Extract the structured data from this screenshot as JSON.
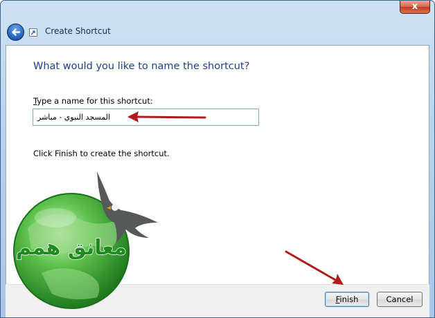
{
  "window": {
    "title": "Create Shortcut",
    "close_glyph": "x",
    "icons": {
      "back": "back-arrow-icon",
      "app": "shortcut-icon",
      "close": "close-icon"
    }
  },
  "wizard": {
    "heading": "What would you like to name the shortcut?",
    "field_label_accesskey": "T",
    "field_label_rest": "ype a name for this shortcut:",
    "name_value": "المسجد النبوي - مباشر",
    "hint": "Click Finish to create the shortcut."
  },
  "buttons": {
    "finish_accesskey": "F",
    "finish_rest": "inish",
    "cancel": "Cancel"
  },
  "watermark": {
    "logo_text": "معانق همم",
    "arrow_color": "#b01c1c",
    "globe_color": "#2f9a2f"
  }
}
